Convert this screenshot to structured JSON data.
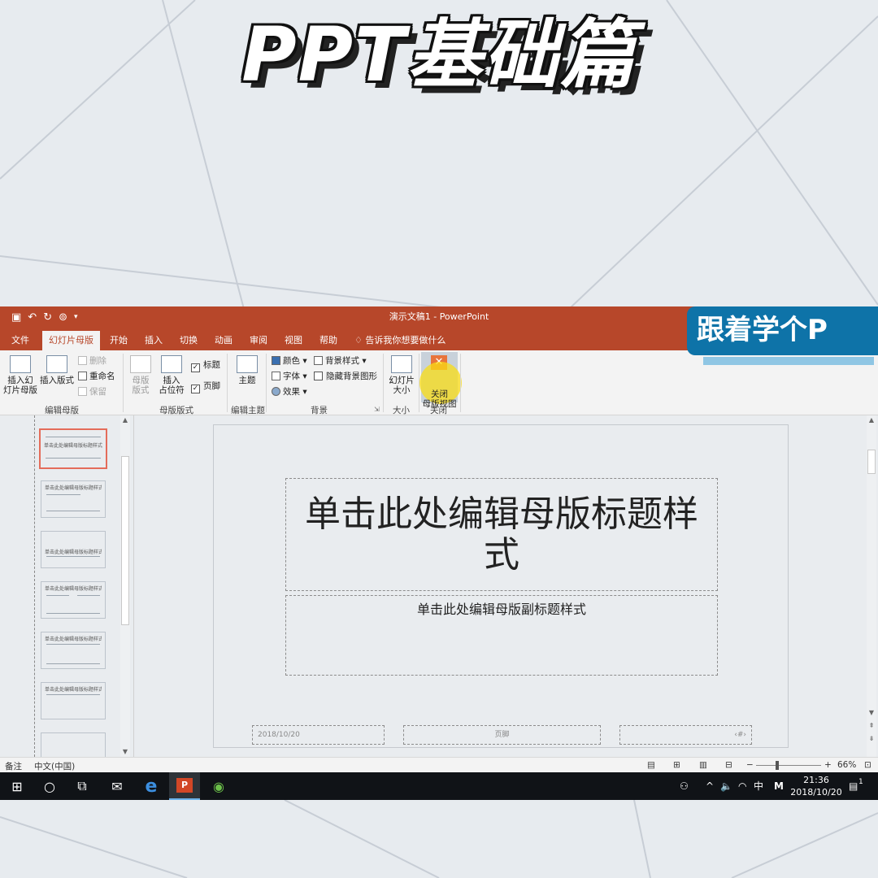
{
  "overlay": {
    "headline": "PPT基础篇",
    "brand": "跟着学个P"
  },
  "app": {
    "doc_title": "演示文稿1  -  PowerPoint",
    "tabs": [
      "文件",
      "幻灯片母版",
      "开始",
      "插入",
      "切换",
      "动画",
      "审阅",
      "视图",
      "帮助"
    ],
    "tell_me": "告诉我你想要做什么",
    "ribbon": {
      "insert_master": "插入幻\n灯片母版",
      "insert_layout": "插入版式",
      "delete": "删除",
      "rename": "重命名",
      "preserve": "保留",
      "group_edit_master": "编辑母版",
      "master_layout": "母版\n版式",
      "insert_placeholder": "插入\n占位符",
      "title_check": "标题",
      "footer_check": "页脚",
      "group_master_layout": "母版版式",
      "themes": "主题",
      "group_edit_theme": "编辑主题",
      "colors": "颜色",
      "fonts": "字体",
      "effects": "效果",
      "bg_styles": "背景样式",
      "hide_bg": "隐藏背景图形",
      "group_background": "背景",
      "slide_size": "幻灯片\n大小",
      "group_size": "大小",
      "close_master": "关闭\n母版视图",
      "group_close": "关闭"
    },
    "thumbnails": [
      {
        "text": "单击此处编辑母版标题样式"
      },
      {
        "text": "单击此处编辑母版标题样式"
      },
      {
        "text": "单击此处编辑母版标题样式"
      },
      {
        "text": "单击此处编辑母版标题样式"
      },
      {
        "text": "单击此处编辑母版标题样式"
      },
      {
        "text": "单击此处编辑母版标题样式"
      },
      {
        "text": ""
      }
    ],
    "slide": {
      "title": "单击此处编辑母版标题样式",
      "subtitle": "单击此处编辑母版副标题样式",
      "date": "2018/10/20",
      "footer": "页脚",
      "number": "‹#›"
    },
    "status": {
      "notes": "备注",
      "language": "中文(中国)",
      "zoom": "66%"
    }
  },
  "taskbar": {
    "ime": "中",
    "time": "21:36",
    "date": "2018/10/20",
    "notification_count": "1"
  }
}
